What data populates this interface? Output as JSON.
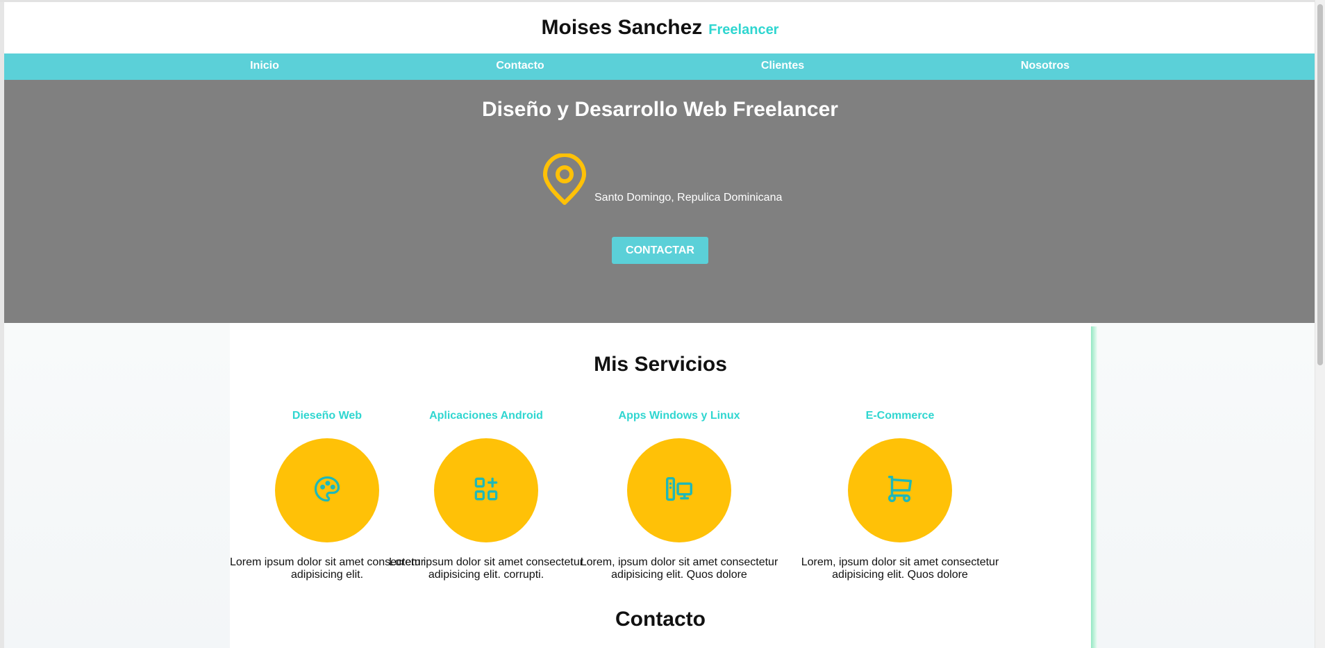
{
  "header": {
    "title": "Moises Sanchez",
    "subtitle": "Freelancer"
  },
  "nav": {
    "items": [
      {
        "label": "Inicio"
      },
      {
        "label": "Contacto"
      },
      {
        "label": "Clientes"
      },
      {
        "label": "Nosotros"
      }
    ]
  },
  "hero": {
    "title": "Diseño y Desarrollo Web Freelancer",
    "location_icon": "map-pin-icon",
    "location": "Santo Domingo, Repulica Dominicana",
    "cta_label": "CONTACTAR"
  },
  "services": {
    "title": "Mis Servicios",
    "items": [
      {
        "title": "Dieseño Web",
        "icon": "palette-icon",
        "description": "Lorem ipsum dolor sit amet consectetur adipisicing elit."
      },
      {
        "title": "Aplicaciones Android",
        "icon": "apps-add-icon",
        "description": "Lorem ipsum dolor sit amet consectetur adipisicing elit. corrupti."
      },
      {
        "title": "Apps Windows y Linux",
        "icon": "devices-icon",
        "description": "Lorem, ipsum dolor sit amet consectetur adipisicing elit. Quos dolore"
      },
      {
        "title": "E-Commerce",
        "icon": "shopping-cart-icon",
        "description": "Lorem, ipsum dolor sit amet consectetur adipisicing elit. Quos dolore"
      }
    ]
  },
  "contact": {
    "title": "Contacto"
  },
  "colors": {
    "accent": "#5bd0d8",
    "accent_text": "#2fd6d0",
    "hero_bg": "#808080",
    "circle": "#ffc107",
    "icon_stroke": "#1fb8b8"
  }
}
